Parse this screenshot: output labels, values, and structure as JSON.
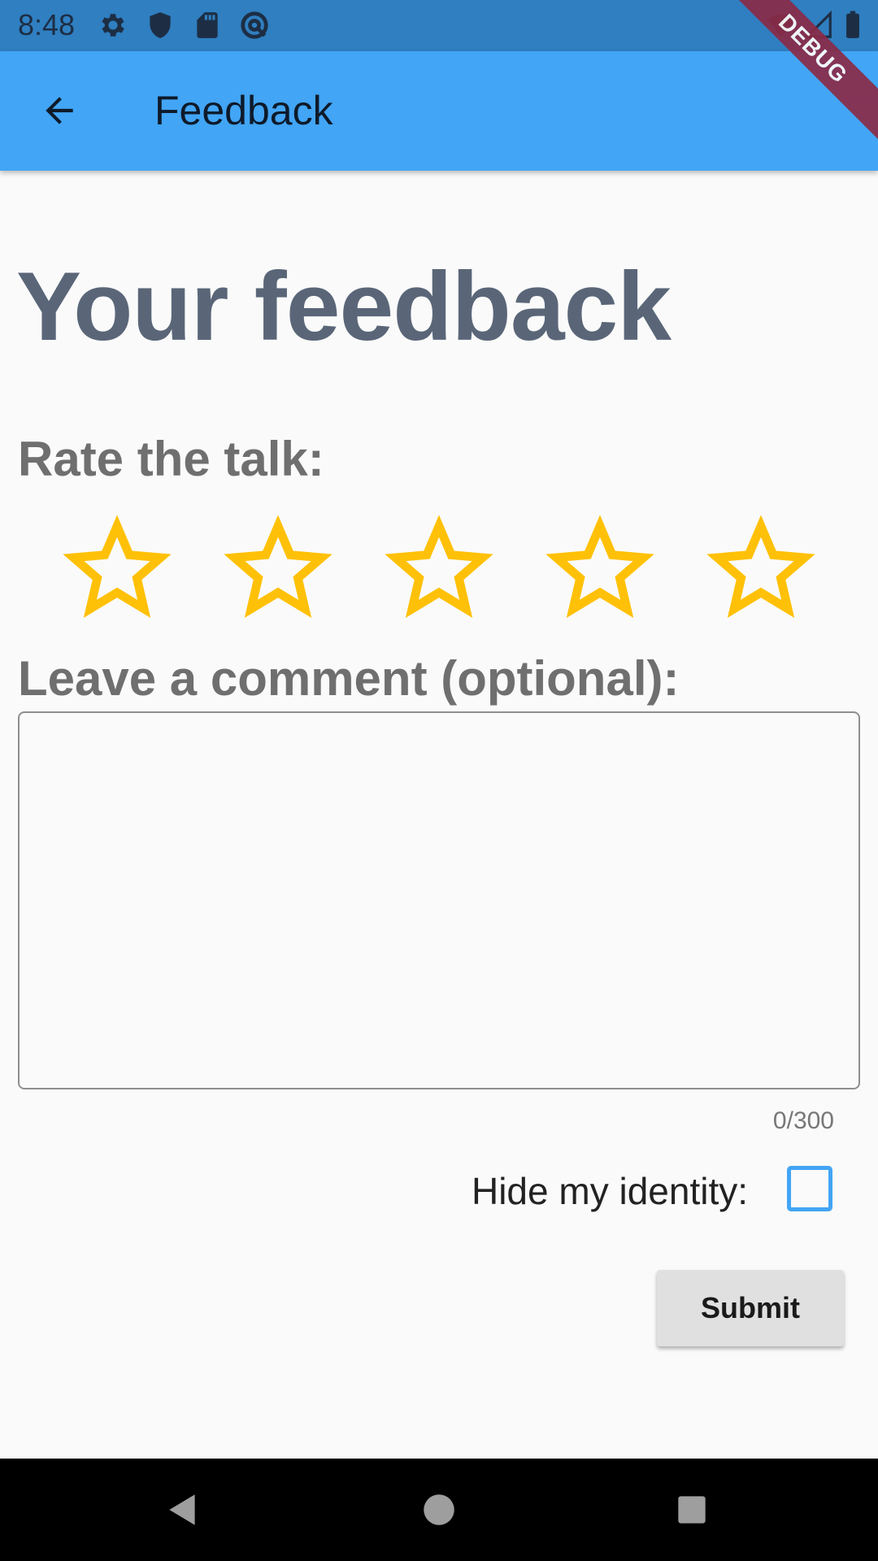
{
  "status_bar": {
    "time": "8:48",
    "icons": [
      "gear-icon",
      "shield-icon",
      "sd-card-icon",
      "at-sign-icon",
      "wifi-icon",
      "signal-icon",
      "battery-icon"
    ]
  },
  "app_bar": {
    "title": "Feedback",
    "back_icon": "arrow-left-icon",
    "debug_banner": "DEBUG",
    "background": "#42a5f5"
  },
  "main": {
    "heading": "Your feedback",
    "rate_label": "Rate the talk:",
    "rating": {
      "value": 0,
      "max": 5,
      "star_color": "#ffc107"
    },
    "comment_label": "Leave a comment (optional):",
    "comment": {
      "value": "",
      "placeholder": ""
    },
    "char_counter": "0/300",
    "hide_identity_label": "Hide my identity:",
    "hide_identity_checked": false,
    "submit_label": "Submit"
  },
  "nav_bar": {
    "buttons": [
      "back-triangle-icon",
      "home-circle-icon",
      "recents-square-icon"
    ]
  }
}
